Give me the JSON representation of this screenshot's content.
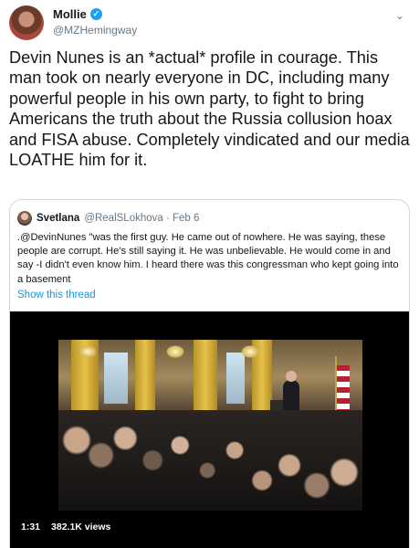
{
  "author": {
    "display_name": "Mollie",
    "handle": "@MZHemingway",
    "verified_icon": "verified-badge-icon"
  },
  "menu_icon": "chevron-down-icon",
  "tweet": {
    "text": "Devin Nunes is an *actual* profile in courage. This man took on nearly everyone in DC, including many powerful people in his own party, to fight to bring Americans the truth about the Russia collusion hoax and FISA abuse. Completely vindicated and our media LOATHE him for it."
  },
  "quoted": {
    "display_name": "Svetlana",
    "handle_date": "@RealSLokhova · Feb 6",
    "text": ".@DevinNunes \"was the first guy. He came out of nowhere. He was saying, these people are corrupt. He's still saying it. He was unbelievable. He would come in and say -I didn't even know him. I heard there was this congressman who kept going into a basement",
    "show_thread": "Show this thread"
  },
  "video": {
    "duration": "1:31",
    "views": "382.1K views"
  },
  "colors": {
    "link": "#1b95e0",
    "verified": "#1da1f2",
    "muted": "#657786"
  }
}
